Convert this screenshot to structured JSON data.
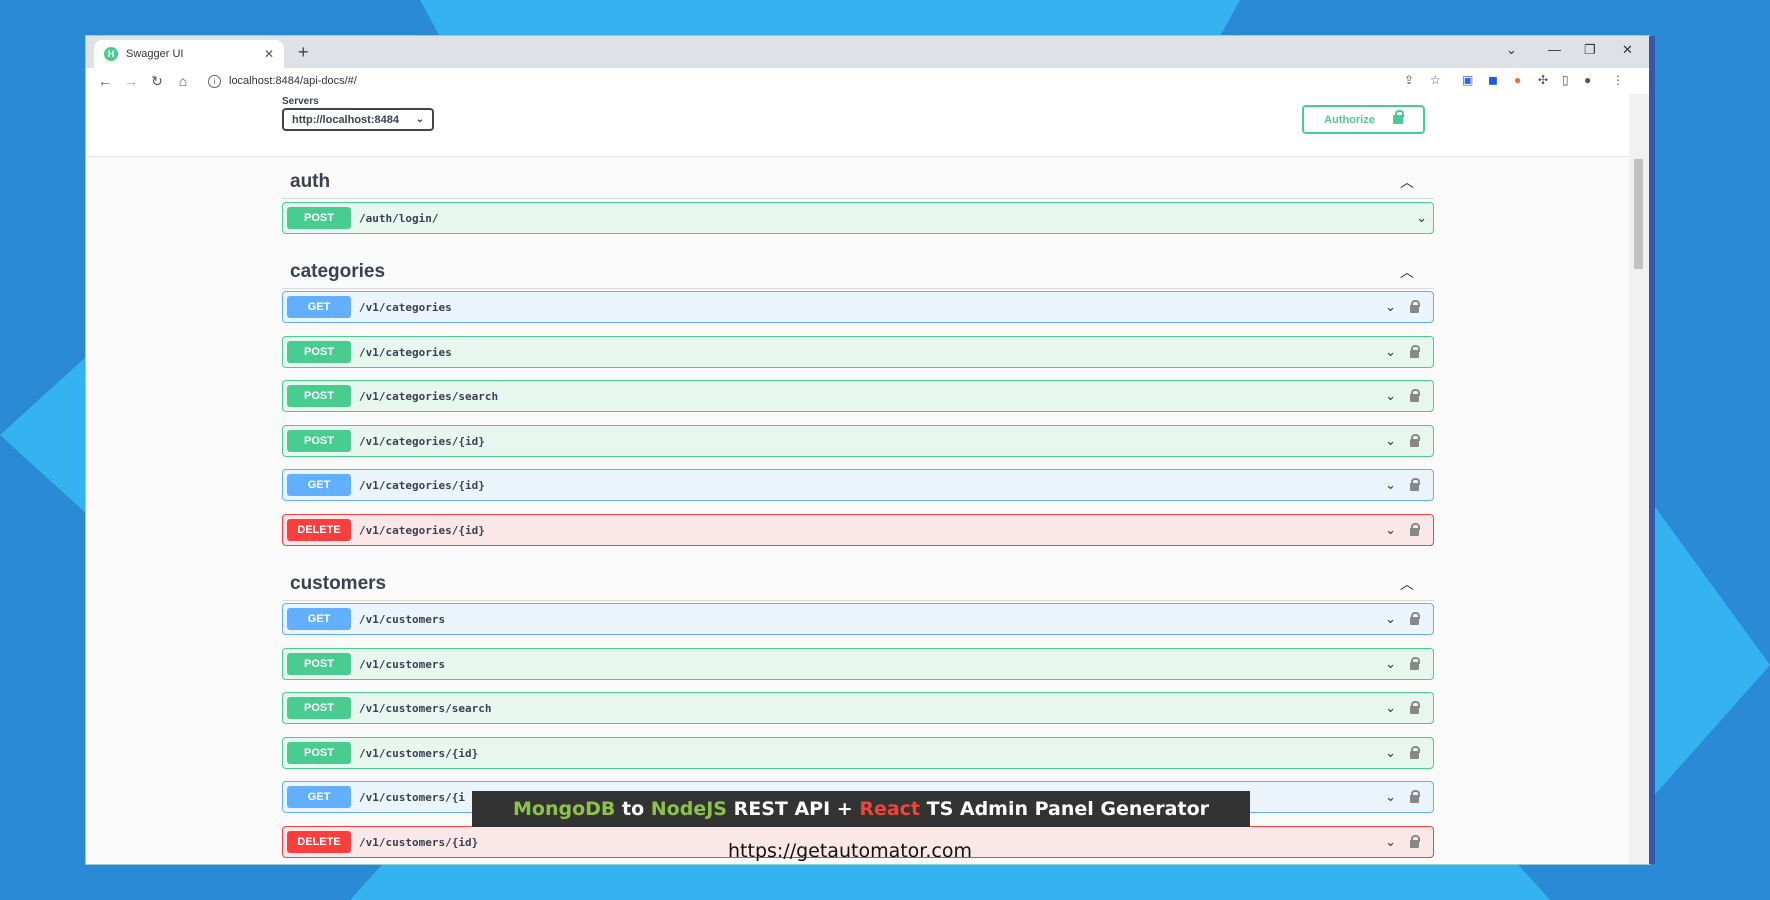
{
  "browser": {
    "tab_title": "Swagger UI",
    "tab_favicon_letter": "H",
    "url": "localhost:8484/api-docs/#/"
  },
  "scheme": {
    "servers_label": "Servers",
    "server_selected": "http://localhost:8484",
    "authorize_label": "Authorize"
  },
  "tags": [
    {
      "name": "auth",
      "ops": [
        {
          "method": "POST",
          "path": "/auth/login/"
        }
      ]
    },
    {
      "name": "categories",
      "ops": [
        {
          "method": "GET",
          "path": "/v1/categories"
        },
        {
          "method": "POST",
          "path": "/v1/categories"
        },
        {
          "method": "POST",
          "path": "/v1/categories/search"
        },
        {
          "method": "POST",
          "path": "/v1/categories/{id}"
        },
        {
          "method": "GET",
          "path": "/v1/categories/{id}"
        },
        {
          "method": "DELETE",
          "path": "/v1/categories/{id}"
        }
      ]
    },
    {
      "name": "customers",
      "ops": [
        {
          "method": "GET",
          "path": "/v1/customers"
        },
        {
          "method": "POST",
          "path": "/v1/customers"
        },
        {
          "method": "POST",
          "path": "/v1/customers/search"
        },
        {
          "method": "POST",
          "path": "/v1/customers/{id}"
        },
        {
          "method": "GET",
          "path": "/v1/customers/{i"
        },
        {
          "method": "DELETE",
          "path": "/v1/customers/{id}"
        }
      ]
    }
  ],
  "overlay": {
    "part1": "MongoDB",
    "part2": " to ",
    "part3": "NodeJS",
    "part4": " REST API + ",
    "part5": "React",
    "part6": " TS Admin Panel Generator",
    "url": "https://getautomator.com"
  },
  "colors": {
    "get": "#61affe",
    "post": "#49cc90",
    "delete": "#f93e3e"
  }
}
